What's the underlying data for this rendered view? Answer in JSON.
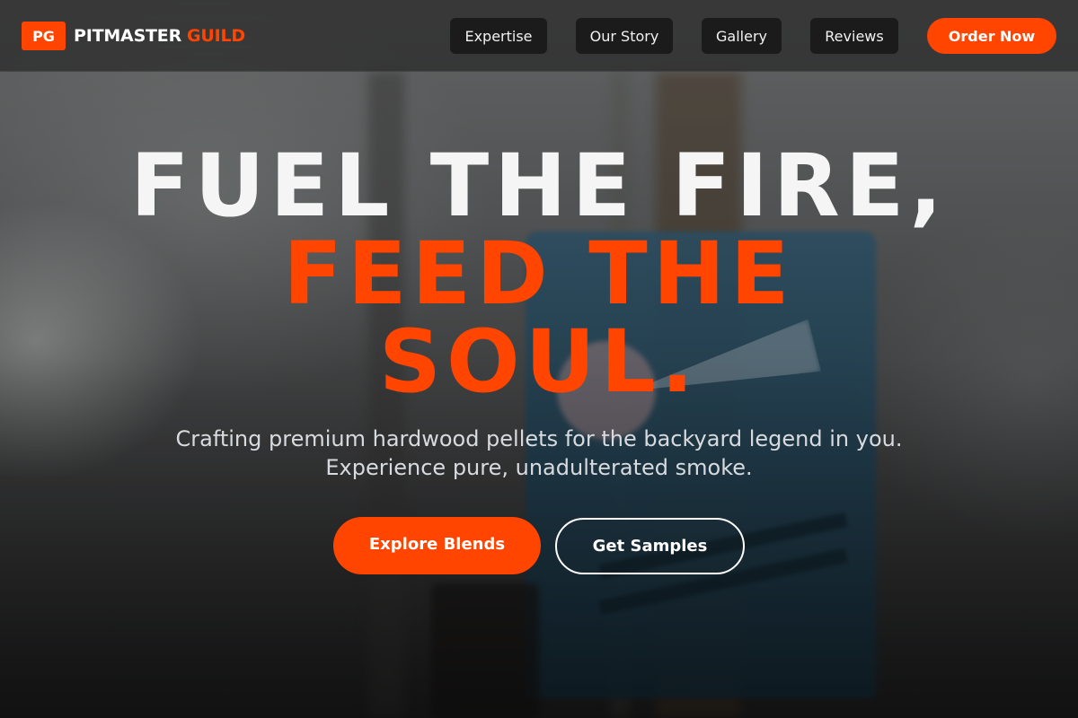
{
  "brand": {
    "badge": "PG",
    "name": "PITMASTER",
    "accent": "GUILD"
  },
  "nav": {
    "links": [
      "Expertise",
      "Our Story",
      "Gallery",
      "Reviews"
    ],
    "cta": "Order Now"
  },
  "hero": {
    "headline_line1": "FUEL THE FIRE,",
    "headline_line2": "FEED THE SOUL.",
    "subtitle_line1": "Crafting premium hardwood pellets for the backyard legend in you.",
    "subtitle_line2": "Experience pure, unadulterated smoke.",
    "primary_cta": "Explore Blends",
    "secondary_cta": "Get Samples"
  },
  "colors": {
    "accent": "#ff4500",
    "nav_bg": "#1b1b1b",
    "text": "#ffffff"
  }
}
